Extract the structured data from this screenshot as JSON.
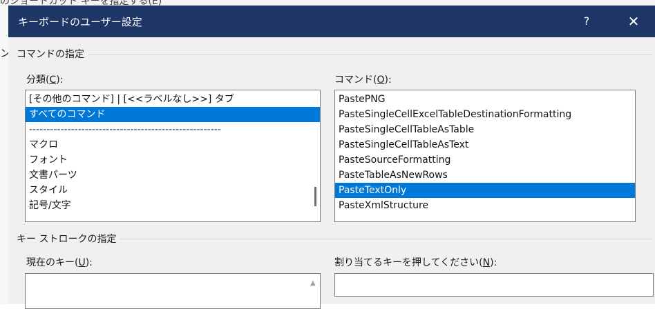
{
  "background_hint": "のショートカット キーを指定する(E)",
  "left_edge_char": "ン",
  "dialog": {
    "title": "キーボードのユーザー設定",
    "help_label": "?",
    "close_label": "✕"
  },
  "command_group": {
    "title": "コマンドの指定",
    "category_label_prefix": "分類(",
    "category_label_key": "C",
    "category_label_suffix": "):",
    "category_items": [
      "[その他のコマンド] | [<<ラベルなし>>] タブ",
      "すべてのコマンド",
      "-------------------------------------------------------",
      "マクロ",
      "フォント",
      "文書パーツ",
      "スタイル",
      "記号/文字"
    ],
    "category_selected_index": 1,
    "command_label_prefix": "コマンド(",
    "command_label_key": "O",
    "command_label_suffix": "):",
    "command_items": [
      "PastePNG",
      "PasteSingleCellExcelTableDestinationFormatting",
      "PasteSingleCellTableAsTable",
      "PasteSingleCellTableAsText",
      "PasteSourceFormatting",
      "PasteTableAsNewRows",
      "PasteTextOnly",
      "PasteXmlStructure"
    ],
    "command_selected_index": 6
  },
  "keystroke_group": {
    "title": "キー ストロークの指定",
    "current_keys_label_prefix": "現在のキー(",
    "current_keys_label_key": "U",
    "current_keys_label_suffix": "):",
    "new_key_label_prefix": "割り当てるキーを押してください(",
    "new_key_label_key": "N",
    "new_key_label_suffix": "):",
    "new_key_value": ""
  },
  "colors": {
    "titlebar": "#1e3666",
    "selection": "#0078d7",
    "dialog_bg": "#f0f0f0"
  }
}
